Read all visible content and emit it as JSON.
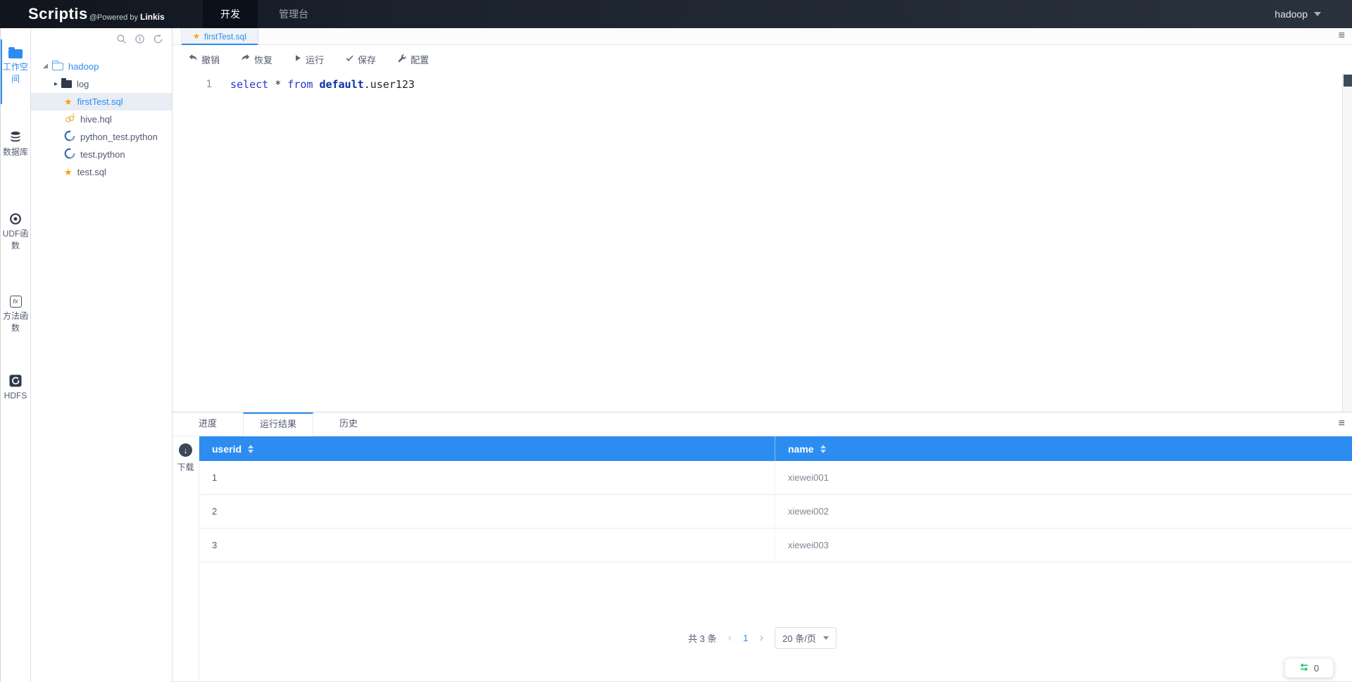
{
  "header": {
    "brand": "Scriptis",
    "brand_suffix": "@Powered by ",
    "brand_linkis": "Linkis",
    "nav_dev": "开发",
    "nav_admin": "管理台",
    "user": "hadoop"
  },
  "activity_bar": {
    "items": [
      {
        "label": "工作空间",
        "active": true
      },
      {
        "label": "数据库",
        "active": false
      },
      {
        "label": "UDF函数",
        "active": false
      },
      {
        "label": "方法函数",
        "active": false
      },
      {
        "label": "HDFS",
        "active": false
      }
    ],
    "fx_glyph": "fx"
  },
  "tree": {
    "nodes": [
      {
        "label": "hadoop",
        "type": "folder-open",
        "expanded": true
      },
      {
        "label": "log",
        "type": "folder",
        "expanded": false
      },
      {
        "label": "firstTest.sql",
        "type": "sql",
        "selected": true
      },
      {
        "label": "hive.hql",
        "type": "hive"
      },
      {
        "label": "python_test.python",
        "type": "python"
      },
      {
        "label": "test.python",
        "type": "python"
      },
      {
        "label": "test.sql",
        "type": "sql"
      }
    ]
  },
  "editor": {
    "tab": "firstTest.sql",
    "toolbar": {
      "undo": "撤销",
      "redo": "恢复",
      "run": "运行",
      "save": "保存",
      "config": "配置"
    },
    "line_number": "1",
    "code": {
      "kw1": "select",
      "p1": " * ",
      "kw2": "from",
      "p2": " ",
      "kw3": "default",
      "p3": ".user123"
    }
  },
  "results": {
    "tab_progress": "进度",
    "tab_result": "运行结果",
    "tab_history": "历史",
    "download": "下载",
    "table": {
      "columns": {
        "c1": "userid",
        "c2": "name"
      },
      "rows": [
        {
          "userid": "1",
          "name": "xiewei001"
        },
        {
          "userid": "2",
          "name": "xiewei002"
        },
        {
          "userid": "3",
          "name": "xiewei003"
        }
      ]
    },
    "pagination": {
      "total": "共 3 条",
      "page": "1",
      "size": "20 条/页"
    }
  },
  "widget": {
    "count": "0"
  },
  "icons": {
    "menu": "≡",
    "star": "★",
    "caret_expanded": "◢",
    "caret_collapsed": "▸",
    "download_arrow": "↓",
    "chevron_left": "‹",
    "chevron_right": "›"
  },
  "colors": {
    "primary": "#2d8cf0",
    "header_bg": "#1b222e",
    "success": "#19be6b",
    "file_star": "#ff9d00"
  }
}
